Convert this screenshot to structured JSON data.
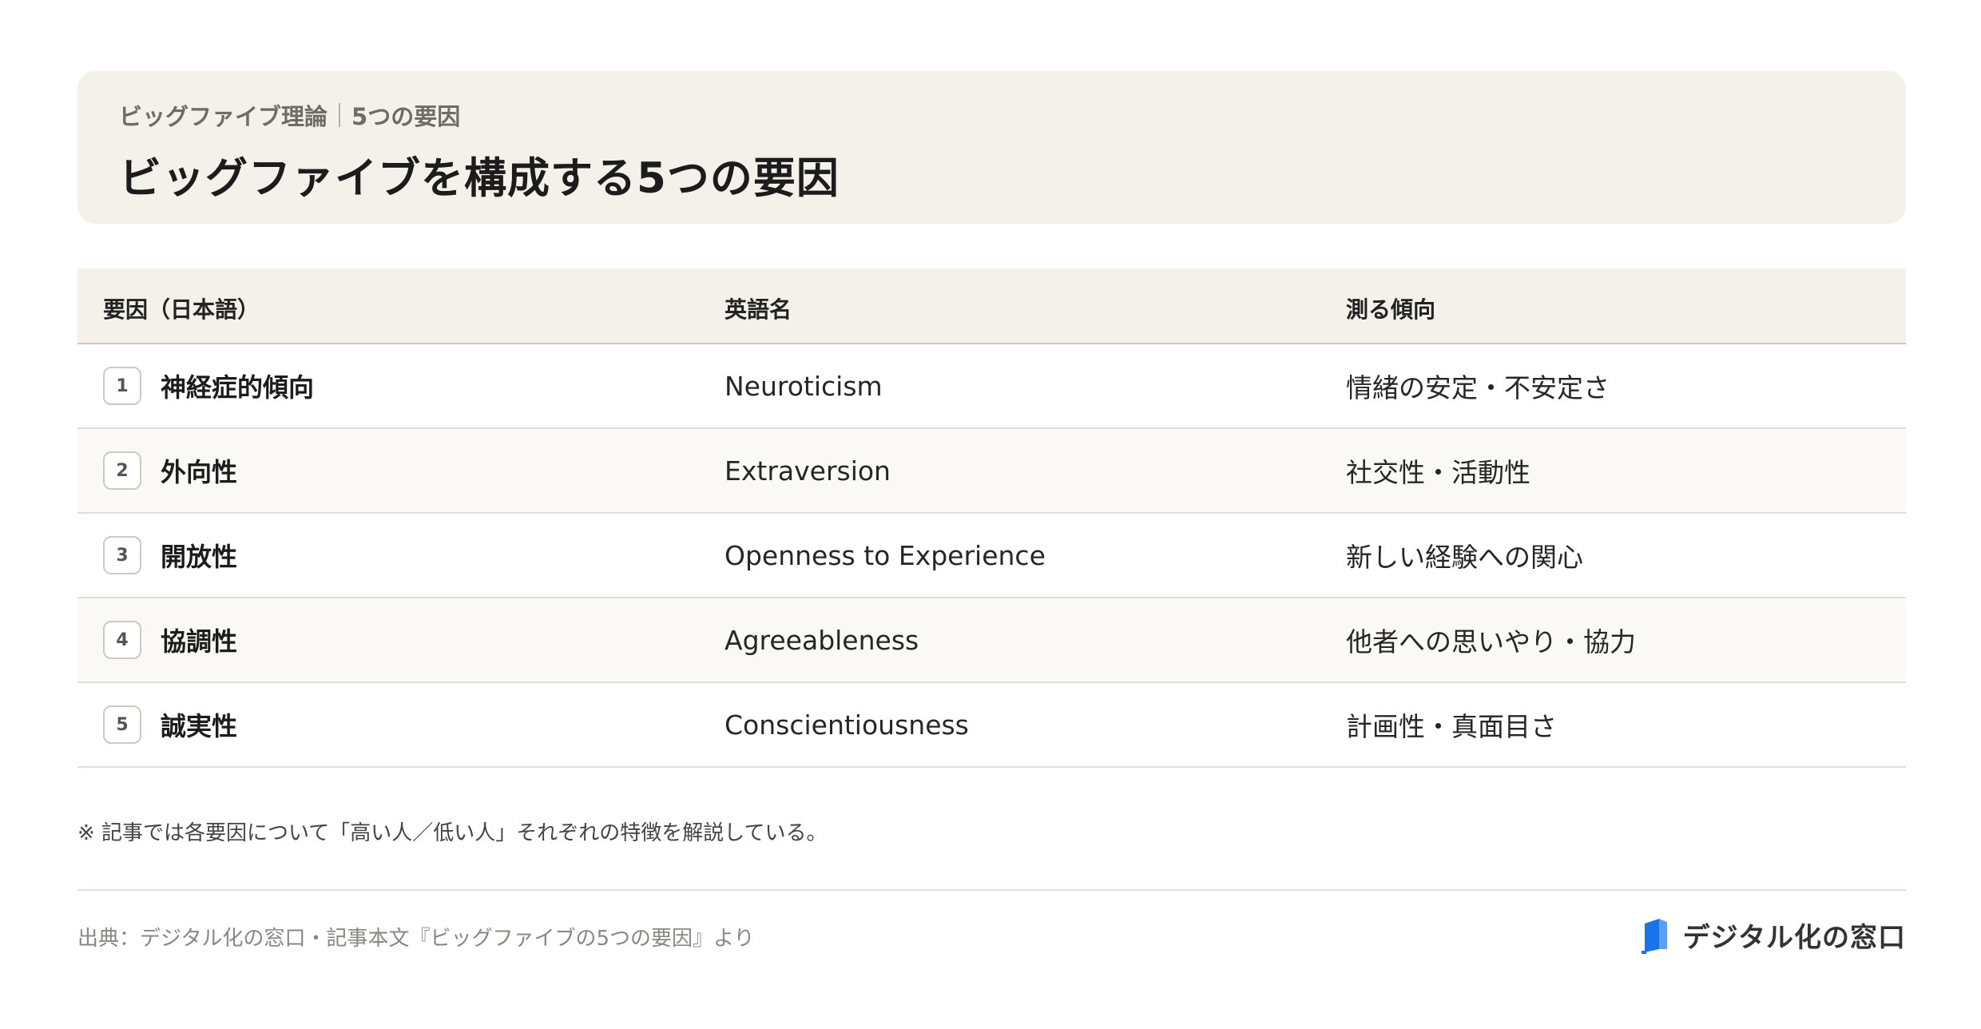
{
  "header": {
    "breadcrumb_topic": "ビッグファイブ理論",
    "breadcrumb_section": "5つの要因",
    "title": "ビッグファイブを構成する5つの要因"
  },
  "table": {
    "columns": [
      "要因（日本語）",
      "英語名",
      "測る傾向"
    ],
    "rows": [
      {
        "number": "1",
        "factor": "神経症的傾向",
        "english": "Neuroticism",
        "trait": "情緒の安定・不安定さ"
      },
      {
        "number": "2",
        "factor": "外向性",
        "english": "Extraversion",
        "trait": "社交性・活動性"
      },
      {
        "number": "3",
        "factor": "開放性",
        "english": "Openness to Experience",
        "trait": "新しい経験への関心"
      },
      {
        "number": "4",
        "factor": "協調性",
        "english": "Agreeableness",
        "trait": "他者への思いやり・協力"
      },
      {
        "number": "5",
        "factor": "誠実性",
        "english": "Conscientiousness",
        "trait": "計画性・真面目さ"
      }
    ]
  },
  "note": "※ 記事では各要因について「高い人／低い人」それぞれの特徴を解説している。",
  "footer": {
    "source": "出典：デジタル化の窓口・記事本文『ビッグファイブの5つの要因』より",
    "brand_name": "デジタル化の窓口",
    "brand_icon": "window-logo-icon",
    "brand_color": "#1a73e8"
  }
}
